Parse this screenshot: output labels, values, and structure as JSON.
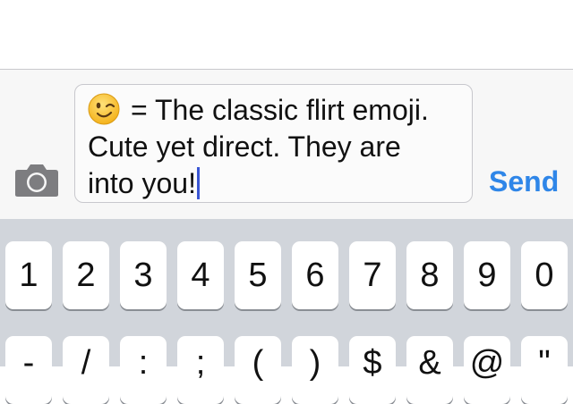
{
  "compose": {
    "emoji": "winking-face",
    "message_parts": {
      "line1": "= The classic flirt emoji.",
      "line2": "Cute yet direct. They are",
      "line3": "into you!"
    },
    "send_label": "Send"
  },
  "keyboard": {
    "row1": [
      "1",
      "2",
      "3",
      "4",
      "5",
      "6",
      "7",
      "8",
      "9",
      "0"
    ],
    "row2": [
      "-",
      "/",
      ":",
      ";",
      "(",
      ")",
      "$",
      "&",
      "@",
      "\""
    ]
  },
  "colors": {
    "send": "#2f86e8",
    "caret": "#3a56d4",
    "keyboard_bg": "#d1d5db"
  }
}
